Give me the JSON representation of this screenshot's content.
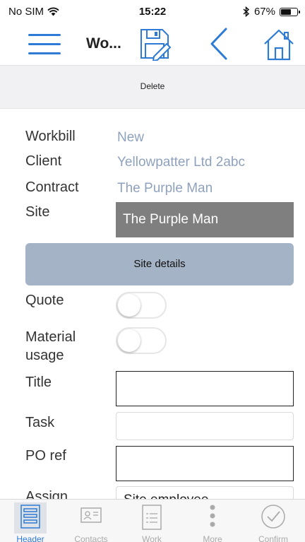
{
  "status_bar": {
    "carrier": "No SIM",
    "time": "15:22",
    "battery": "67%",
    "battery_level": 0.67
  },
  "navbar": {
    "title": "Wo..."
  },
  "actionbar": {
    "delete_label": "Delete"
  },
  "form": {
    "workbill_label": "Workbill",
    "workbill_value": "New",
    "client_label": "Client",
    "client_value": "Yellowpatter Ltd 2abc",
    "contract_label": "Contract",
    "contract_value": "The Purple Man",
    "site_label": "Site",
    "site_value": "The Purple Man",
    "site_details_button": "Site details",
    "quote_label": "Quote",
    "material_usage_label": "Material usage",
    "title_label": "Title",
    "task_label": "Task",
    "po_ref_label": "PO ref",
    "assign_label": "Assign",
    "assign_value": "Site employee"
  },
  "tabs": [
    {
      "label": "Header",
      "icon": "header-icon",
      "active": true
    },
    {
      "label": "Contacts",
      "icon": "contacts-icon",
      "active": false
    },
    {
      "label": "Work",
      "icon": "work-icon",
      "active": false
    },
    {
      "label": "More",
      "icon": "more-icon",
      "active": false
    },
    {
      "label": "Confirm",
      "icon": "confirm-icon",
      "active": false
    }
  ],
  "colors": {
    "accent": "#2e7bd6",
    "link_value": "#8fa2bd",
    "site_details_bg": "#a5b3c6",
    "site_field_bg": "#7f7f7f"
  }
}
